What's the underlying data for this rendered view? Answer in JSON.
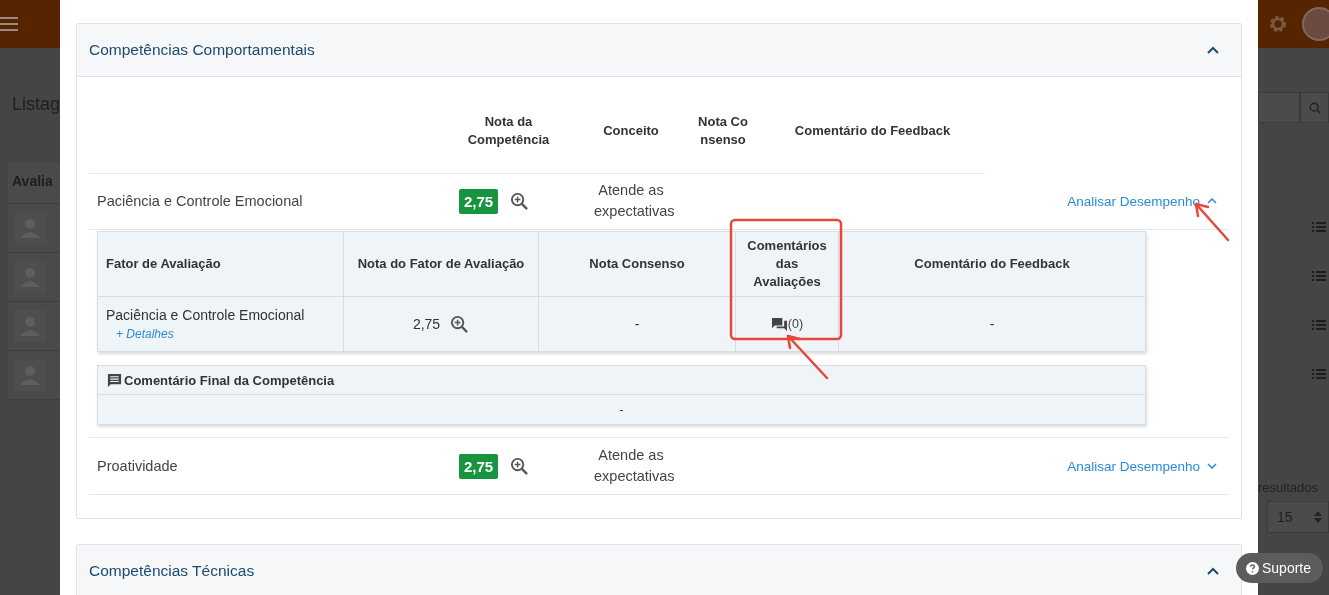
{
  "background": {
    "page_title": "Listag",
    "table_header": "Avalia",
    "list_rows": [
      {
        "kind": "user"
      },
      {
        "kind": "user"
      },
      {
        "kind": "user"
      },
      {
        "kind": "user"
      }
    ],
    "results_label": "resultados",
    "page_size": "15"
  },
  "sections": [
    {
      "title": "Competências Comportamentais",
      "expanded": true,
      "columns": [
        "Nota da Competência",
        "Conceito",
        "Nota Consenso",
        "Comentário do Feedback"
      ],
      "rows": [
        {
          "name": "Paciência e Controle Emocional",
          "grade": "2,75",
          "concept": "Atende as expectativas",
          "link": "Analisar Desempenho",
          "expanded": true,
          "factor_columns": [
            "Fator de Avaliação",
            "Nota do Fator de Avaliação",
            "Nota Consenso",
            "Comentários das Avaliações",
            "Comentário do Feedback"
          ],
          "factors": [
            {
              "name": "Paciência e Controle Emocional",
              "details_link": "+ Detalhes",
              "grade": "2,75",
              "consensus": "-",
              "comments": "(0)",
              "feedback": "-"
            }
          ],
          "final_comment": {
            "title": "Comentário Final da Competência",
            "value": "-"
          }
        },
        {
          "name": "Proatividade",
          "grade": "2,75",
          "concept": "Atende as expectativas",
          "link": "Analisar Desempenho",
          "expanded": false
        }
      ]
    },
    {
      "title": "Competências Técnicas",
      "expanded": true
    }
  ],
  "support_button": "Suporte"
}
